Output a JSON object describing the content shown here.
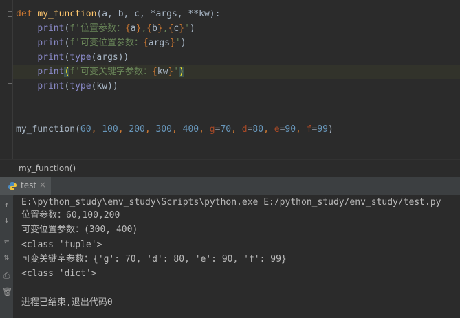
{
  "editor": {
    "line1": {
      "kw_def": "def",
      "fn_name": "my_function",
      "open": "(",
      "params": "a, b, c, *args, **kw",
      "close": "):"
    },
    "line2": {
      "print": "print",
      "open": "(",
      "prefix": "f'",
      "text": "位置参数：",
      "b1": "{",
      "v1": "a",
      "b2": "}",
      "sep1": ",",
      "b3": "{",
      "v2": "b",
      "b4": "}",
      "sep2": ",",
      "b5": "{",
      "v3": "c",
      "b6": "}",
      "end": "'",
      "close": ")"
    },
    "line3": {
      "print": "print",
      "open": "(",
      "prefix": "f'",
      "text": "可变位置参数：",
      "b1": "{",
      "v1": "args",
      "b2": "}",
      "end": "'",
      "close": ")"
    },
    "line4": {
      "print": "print",
      "open": "(",
      "type": "type",
      "inner": "(args))"
    },
    "line5": {
      "print": "print",
      "open": "(",
      "prefix": "f'",
      "text": "可变关键字参数：",
      "b1": "{",
      "v1": "kw",
      "b2": "}",
      "end": "'",
      "close": ")"
    },
    "line6": {
      "print": "print",
      "open": "(",
      "type": "type",
      "inner": "(kw))"
    },
    "call": {
      "fn_name": "my_function",
      "open": "(",
      "n1": "60",
      "n2": "100",
      "n3": "200",
      "n4": "300",
      "n5": "400",
      "k1": "g",
      "v1": "70",
      "k2": "d",
      "v2": "80",
      "k3": "e",
      "v3": "90",
      "k4": "f",
      "v4": "99",
      "comma": ", ",
      "eq": "=",
      "close": ")"
    }
  },
  "breadcrumb": {
    "label": "my_function()"
  },
  "run_tab": {
    "label": "test",
    "close": "×"
  },
  "console": {
    "lines": [
      "E:\\python_study\\env_study\\Scripts\\python.exe E:/python_study/env_study/test.py",
      "位置参数：60,100,200",
      "可变位置参数：(300, 400)",
      "<class 'tuple'>",
      "可变关键字参数：{'g': 70, 'd': 80, 'e': 90, 'f': 99}",
      "<class 'dict'>",
      "",
      "进程已结束,退出代码0"
    ]
  },
  "icons": {
    "up": "↑",
    "down": "↓",
    "wrap": "⇌",
    "sort": "⇅",
    "print": "⎙",
    "trash": "🗑"
  },
  "colors": {
    "keyword": "#cc7832",
    "function": "#ffc66d",
    "builtin": "#8888c6",
    "string": "#6a8759",
    "number": "#6897bb",
    "param": "#aa4926",
    "text": "#a9b7c6"
  }
}
